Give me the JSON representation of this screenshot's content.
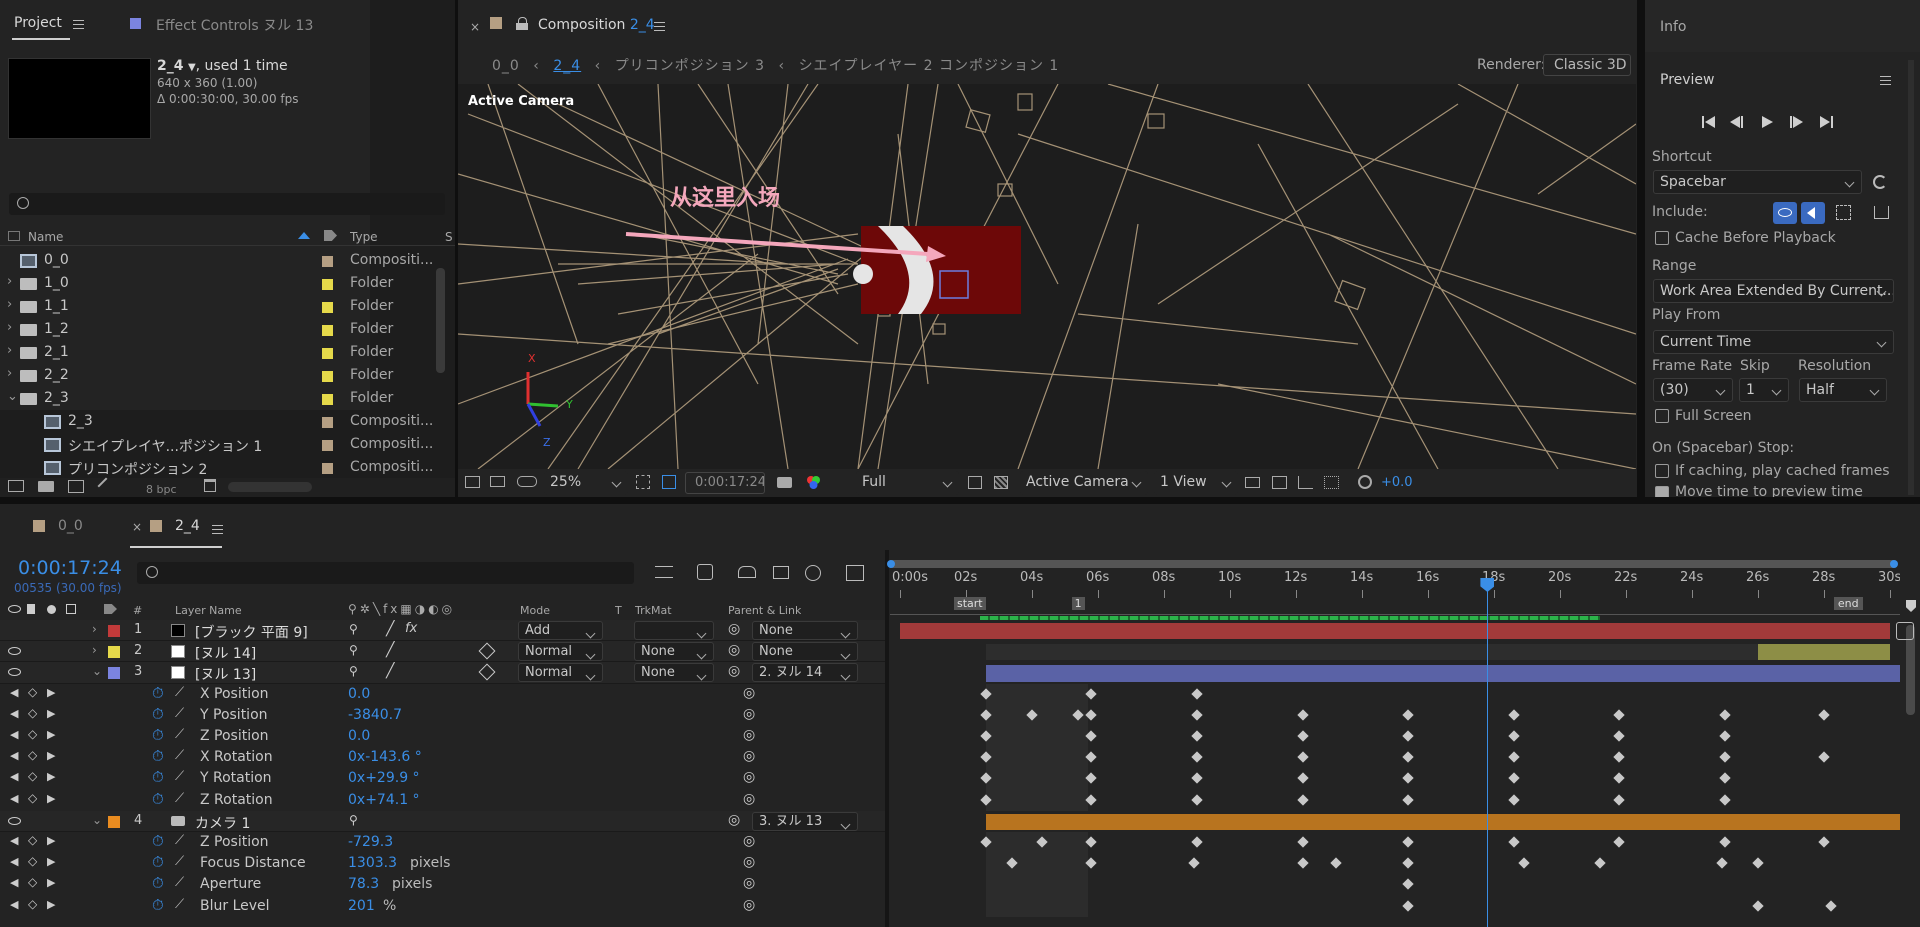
{
  "project_panel": {
    "tab_project": "Project",
    "tab_effect_controls": "Effect Controls ヌル 13",
    "comp_name": "2_4",
    "used_text": ", used 1 time",
    "resolution": "640 x 360 (1.00)",
    "duration": "Δ 0:00:30:00, 30.00 fps",
    "search_placeholder": "",
    "col_name": "Name",
    "col_type": "Type",
    "col_s": "S",
    "bpc": "8 bpc",
    "items": [
      {
        "name": "0_0",
        "type": "Compositi...",
        "color": "#b59f83",
        "kind": "comp",
        "indent": 0,
        "expander": ""
      },
      {
        "name": "1_0",
        "type": "Folder",
        "color": "#e5d94a",
        "kind": "folder",
        "indent": 0,
        "expander": "›"
      },
      {
        "name": "1_1",
        "type": "Folder",
        "color": "#e5d94a",
        "kind": "folder",
        "indent": 0,
        "expander": "›"
      },
      {
        "name": "1_2",
        "type": "Folder",
        "color": "#e5d94a",
        "kind": "folder",
        "indent": 0,
        "expander": "›"
      },
      {
        "name": "2_1",
        "type": "Folder",
        "color": "#e5d94a",
        "kind": "folder",
        "indent": 0,
        "expander": "›"
      },
      {
        "name": "2_2",
        "type": "Folder",
        "color": "#e5d94a",
        "kind": "folder",
        "indent": 0,
        "expander": "›"
      },
      {
        "name": "2_3",
        "type": "Folder",
        "color": "#e5d94a",
        "kind": "folder",
        "indent": 0,
        "expander": "⌄"
      },
      {
        "name": "2_3",
        "type": "Compositi...",
        "color": "#b59f83",
        "kind": "comp",
        "indent": 1,
        "expander": ""
      },
      {
        "name": "シエイプレイヤ...ポジション 1",
        "type": "Compositi...",
        "color": "#b59f83",
        "kind": "comp",
        "indent": 1,
        "expander": ""
      },
      {
        "name": "プリコンポジション 2",
        "type": "Compositi...",
        "color": "#b59f83",
        "kind": "comp",
        "indent": 1,
        "expander": ""
      }
    ]
  },
  "composition_panel": {
    "tab_label": "Composition",
    "tab_comp": "2_4",
    "breadcrumbs": [
      "0_0",
      "2_4",
      "プリコンポジション 3",
      "シエイプレイヤー 2 コンポジション 1"
    ],
    "renderer_label": "Renderer:",
    "renderer_value": "Classic 3D",
    "viewer_label": "Active Camera",
    "annotation": "从这里入场",
    "axis_x": "X",
    "axis_y": "Y",
    "axis_z": "Z",
    "zoom": "25%",
    "timecode": "0:00:17:24",
    "resolution": "Full",
    "camera": "Active Camera",
    "views": "1 View",
    "exposure": "+0.0"
  },
  "right_panel": {
    "info_tab": "Info",
    "preview_title": "Preview",
    "shortcut_label": "Shortcut",
    "shortcut_value": "Spacebar",
    "include_label": "Include:",
    "cache_before": "Cache Before Playback",
    "range_label": "Range",
    "range_value": "Work Area Extended By Current...",
    "play_from_label": "Play From",
    "play_from_value": "Current Time",
    "frame_rate_label": "Frame Rate",
    "frame_rate_value": "(30)",
    "skip_label": "Skip",
    "skip_value": "1",
    "resolution_label": "Resolution",
    "resolution_value": "Half",
    "full_screen": "Full Screen",
    "on_stop": "On (Spacebar) Stop:",
    "if_caching": "If caching, play cached frames",
    "move_time": "Move time to preview time"
  },
  "timeline": {
    "tab_0": "0_0",
    "tab_1": "2_4",
    "current_time": "0:00:17:24",
    "frame_info": "00535 (30.00 fps)",
    "col_num": "#",
    "col_layer": "Layer Name",
    "col_mode": "Mode",
    "col_t": "T",
    "col_trkmat": "TrkMat",
    "col_parent": "Parent & Link",
    "ruler": [
      "0:00s",
      "02s",
      "04s",
      "06s",
      "08s",
      "10s",
      "12s",
      "14s",
      "16s",
      "18s",
      "20s",
      "22s",
      "24s",
      "26s",
      "28s",
      "30s"
    ],
    "marker_start": "start",
    "marker_end": "end",
    "marker_1": "1",
    "layers": [
      {
        "num": "1",
        "name": "[ブラック 平面 9]",
        "label_color": "#c23a3a",
        "swatch": "#000000",
        "mode": "Add",
        "trkmat": "",
        "parent": "None",
        "bar_color": "#a23a3a",
        "bar_start": 0,
        "bar_end": 30
      },
      {
        "num": "2",
        "name": "[ヌル 14]",
        "label_color": "#e5d94a",
        "swatch": "#ffffff",
        "mode": "Normal",
        "trkmat": "None",
        "parent": "None",
        "bar_color": "#8d8e46",
        "bar_start": 26,
        "bar_end": 30
      },
      {
        "num": "3",
        "name": "[ヌル 13]",
        "label_color": "#7b84e0",
        "swatch": "#ffffff",
        "mode": "Normal",
        "trkmat": "None",
        "parent": "2. ヌル 14",
        "bar_color": "#5a62a6",
        "bar_start": 2.6,
        "bar_end": 30.3
      },
      {
        "num": "4",
        "name": "カメラ 1",
        "label_color": "#ea8c20",
        "swatch": "",
        "mode": "",
        "trkmat": "",
        "parent": "3. ヌル 13",
        "bar_color": "#b8741f",
        "bar_start": 2.6,
        "bar_end": 30.3
      }
    ],
    "layer3_props": [
      {
        "name": "X Position",
        "value": "0.0",
        "unit": ""
      },
      {
        "name": "Y Position",
        "value": "-3840.7",
        "unit": ""
      },
      {
        "name": "Z Position",
        "value": "0.0",
        "unit": ""
      },
      {
        "name": "X Rotation",
        "value": "0x-143.6 °",
        "unit": ""
      },
      {
        "name": "Y Rotation",
        "value": "0x+29.9 °",
        "unit": ""
      },
      {
        "name": "Z Rotation",
        "value": "0x+74.1 °",
        "unit": ""
      }
    ],
    "layer4_props": [
      {
        "name": "Z Position",
        "value": "-729.3",
        "unit": ""
      },
      {
        "name": "Focus Distance",
        "value": "1303.3",
        "unit": "pixels"
      },
      {
        "name": "Aperture",
        "value": "78.3",
        "unit": "pixels"
      },
      {
        "name": "Blur Level",
        "value": "201",
        "unit": "%"
      }
    ]
  },
  "colors": {
    "accent_blue": "#3a8ee6",
    "panel_bg": "#232323",
    "playhead": "#3a8ee6"
  }
}
